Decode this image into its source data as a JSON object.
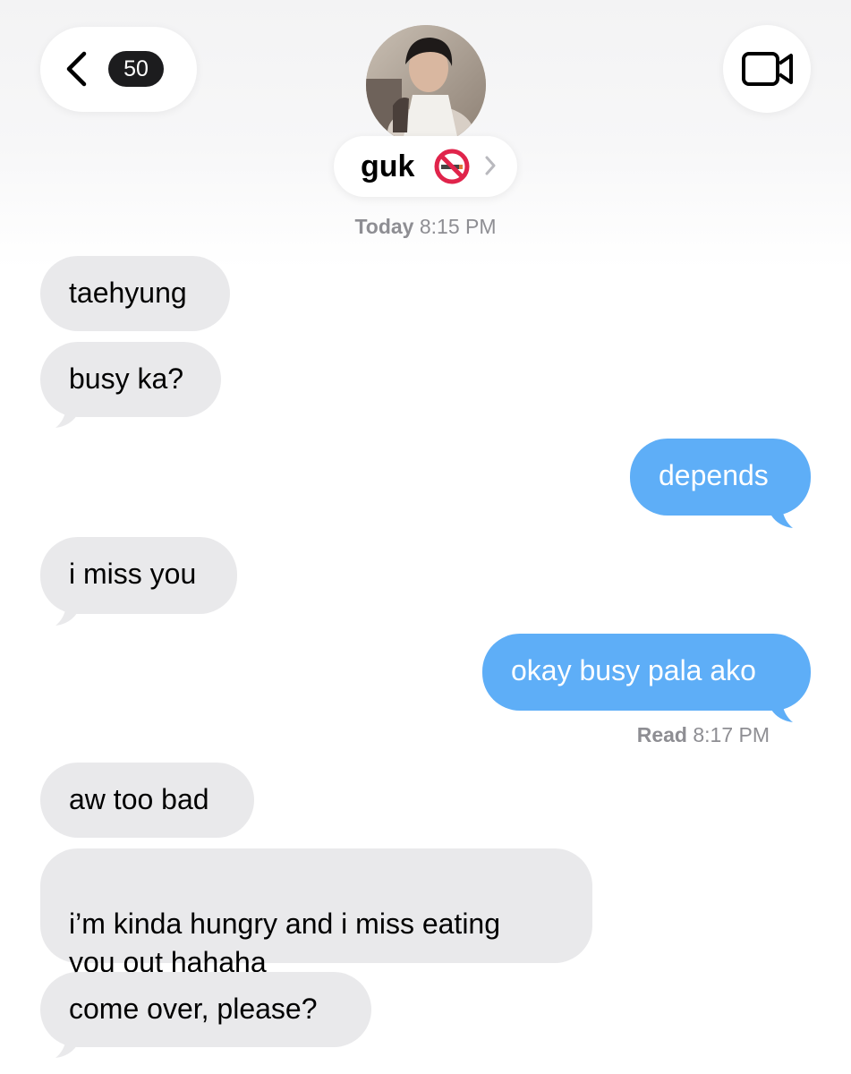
{
  "header": {
    "unread_count": "50",
    "contact_name": "guk",
    "contact_emoji": "no-smoking-icon"
  },
  "timestamps": {
    "first": {
      "day": "Today",
      "time": "8:15 PM"
    }
  },
  "read_receipt": {
    "label": "Read",
    "time": "8:17 PM"
  },
  "messages": [
    {
      "sender": "them",
      "text": "taehyung"
    },
    {
      "sender": "them",
      "text": "busy ka?"
    },
    {
      "sender": "me",
      "text": "depends"
    },
    {
      "sender": "them",
      "text": "i miss you"
    },
    {
      "sender": "me",
      "text": "okay busy pala ako"
    },
    {
      "sender": "them",
      "text": "aw too bad"
    },
    {
      "sender": "them",
      "text": "i’m kinda hungry and i miss eating\nyou out hahaha"
    },
    {
      "sender": "them",
      "text": "come over, please?"
    }
  ],
  "colors": {
    "incoming_bubble": "#e9e9eb",
    "outgoing_bubble": "#5eaef7",
    "meta_text": "#8e8e93"
  }
}
